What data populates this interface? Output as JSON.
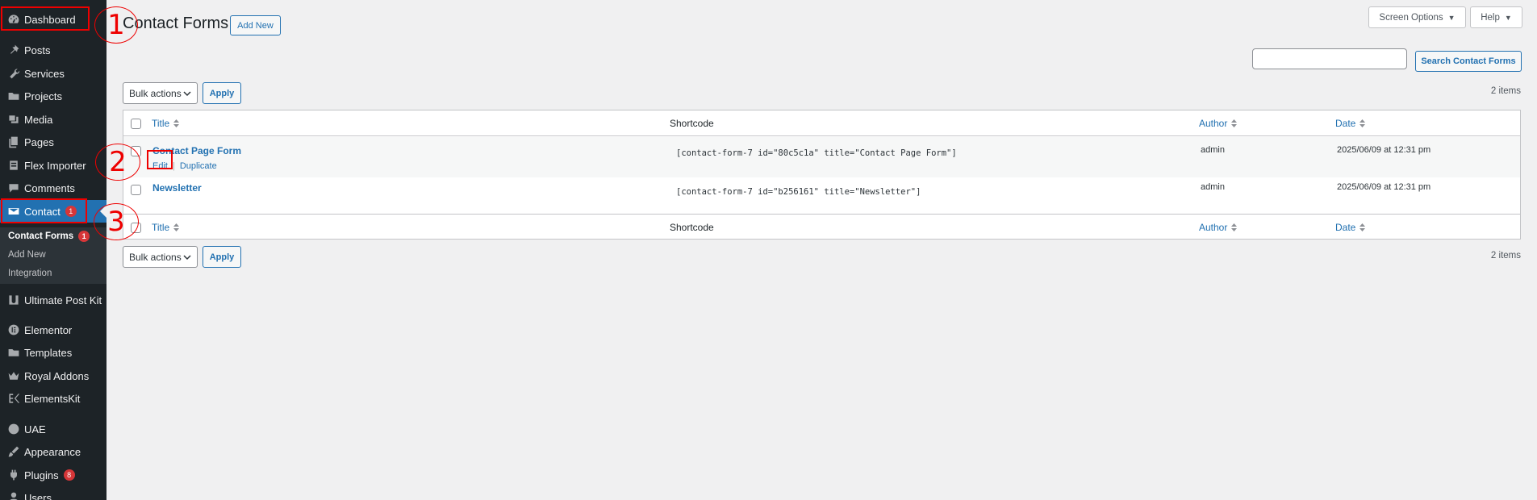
{
  "sidebar": {
    "items": [
      {
        "label": "Dashboard",
        "icon": "dashboard-icon"
      },
      {
        "label": "Posts",
        "icon": "pin-icon"
      },
      {
        "label": "Services",
        "icon": "wrench-icon"
      },
      {
        "label": "Projects",
        "icon": "folder-icon"
      },
      {
        "label": "Media",
        "icon": "media-icon"
      },
      {
        "label": "Pages",
        "icon": "pages-icon"
      },
      {
        "label": "Flex Importer",
        "icon": "importer-icon"
      },
      {
        "label": "Comments",
        "icon": "comment-icon"
      },
      {
        "label": "Contact",
        "icon": "mail-icon",
        "badge": "1"
      },
      {
        "label": "Ultimate Post Kit",
        "icon": "upk-icon"
      },
      {
        "label": "Elementor",
        "icon": "elementor-icon"
      },
      {
        "label": "Templates",
        "icon": "folder-icon"
      },
      {
        "label": "Royal Addons",
        "icon": "crown-icon"
      },
      {
        "label": "ElementsKit",
        "icon": "ek-icon"
      },
      {
        "label": "UAE",
        "icon": "uae-icon"
      },
      {
        "label": "Appearance",
        "icon": "brush-icon"
      },
      {
        "label": "Plugins",
        "icon": "plugin-icon",
        "badge": "8"
      },
      {
        "label": "Users",
        "icon": "user-icon"
      }
    ],
    "submenu": [
      {
        "label": "Contact Forms",
        "badge": "1"
      },
      {
        "label": "Add New"
      },
      {
        "label": "Integration"
      }
    ]
  },
  "header": {
    "title": "Contact Forms",
    "add_new": "Add New",
    "screen_options": "Screen Options",
    "help": "Help"
  },
  "search": {
    "value": "",
    "button": "Search Contact Forms"
  },
  "bulk": {
    "label": "Bulk actions",
    "apply": "Apply"
  },
  "items_count": "2 items",
  "table": {
    "columns": {
      "title": "Title",
      "shortcode": "Shortcode",
      "author": "Author",
      "date": "Date"
    },
    "rows": [
      {
        "title": "Contact Page Form",
        "shortcode": "[contact-form-7 id=\"80c5c1a\" title=\"Contact Page Form\"]",
        "author": "admin",
        "date": "2025/06/09 at 12:31 pm",
        "actions": [
          "Edit",
          "Duplicate"
        ]
      },
      {
        "title": "Newsletter",
        "shortcode": "[contact-form-7 id=\"b256161\" title=\"Newsletter\"]",
        "author": "admin",
        "date": "2025/06/09 at 12:31 pm"
      }
    ]
  },
  "annotations": [
    "1",
    "2",
    "3"
  ],
  "colors": {
    "accent": "#2271b1",
    "sidebar": "#1d2327",
    "badge": "#d63638",
    "annotation": "#ee0000"
  }
}
